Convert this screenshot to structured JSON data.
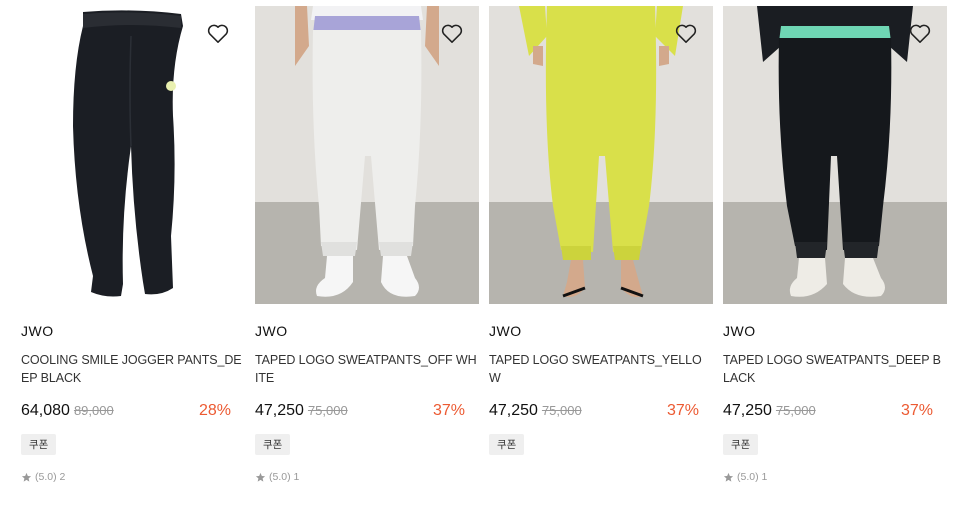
{
  "products": [
    {
      "brand": "JWO",
      "name": "COOLING SMILE JOGGER PANTS_DEEP BLACK",
      "price": "64,080",
      "original_price": "89,000",
      "discount": "28%",
      "coupon": "쿠폰",
      "rating": "(5.0) 2",
      "image": "black-jogger-pants-flat",
      "pants_color": "#1b1e24",
      "bg_color": "#ffffff"
    },
    {
      "brand": "JWO",
      "name": "TAPED LOGO SWEATPANTS_OFF WHITE",
      "price": "47,250",
      "original_price": "75,000",
      "discount": "37%",
      "coupon": "쿠폰",
      "rating": "(5.0) 1",
      "image": "off-white-sweatpants-model",
      "pants_color": "#eeeeec",
      "bg_color": "#d8d6d2"
    },
    {
      "brand": "JWO",
      "name": "TAPED LOGO SWEATPANTS_YELLOW",
      "price": "47,250",
      "original_price": "75,000",
      "discount": "37%",
      "coupon": "쿠폰",
      "rating": "",
      "image": "yellow-sweatpants-model",
      "pants_color": "#d9e04a",
      "bg_color": "#d8d6d2"
    },
    {
      "brand": "JWO",
      "name": "TAPED LOGO SWEATPANTS_DEEP BLACK",
      "price": "47,250",
      "original_price": "75,000",
      "discount": "37%",
      "coupon": "쿠폰",
      "rating": "(5.0) 1",
      "image": "black-sweatpants-model",
      "pants_color": "#15181c",
      "bg_color": "#d8d6d2"
    }
  ],
  "accent_color": "#ec5a32",
  "icons": {
    "wishlist": "heart-icon",
    "rating": "star-icon"
  }
}
